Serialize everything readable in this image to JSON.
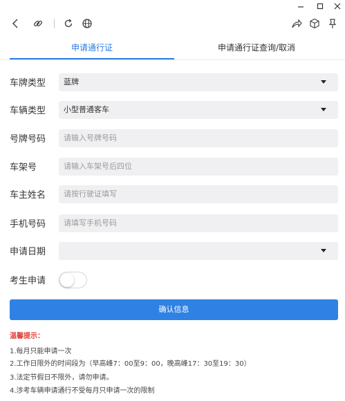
{
  "tabs": {
    "apply": "申请通行证",
    "query": "申请通行证查询/取消"
  },
  "form": {
    "plate_type": {
      "label": "车牌类型",
      "value": "蓝牌"
    },
    "vehicle_type": {
      "label": "车辆类型",
      "value": "小型普通客车"
    },
    "plate_number": {
      "label": "号牌号码",
      "placeholder": "请输入号牌号码"
    },
    "vin": {
      "label": "车架号",
      "placeholder": "请输入车架号后四位"
    },
    "owner_name": {
      "label": "车主姓名",
      "placeholder": "请按行驶证填写"
    },
    "phone": {
      "label": "手机号码",
      "placeholder": "请填写手机号码"
    },
    "apply_date": {
      "label": "申请日期",
      "value": ""
    },
    "examinee": {
      "label": "考生申请",
      "enabled": false
    }
  },
  "confirm_button": "确认信息",
  "tips": {
    "title": "温馨提示：",
    "items": [
      "1.每月只能申请一次",
      "2.工作日限外的时间段为（早高峰7：00至9：00，晚高峰17：30至19：30）",
      "3.法定节假日不限外，请勿申请。",
      "4.涉考车辆申请通行不受每月只申请一次的限制"
    ]
  },
  "colors": {
    "accent": "#2b7de0",
    "button": "#2f82e4",
    "tips_title": "#e0413b",
    "field_bg": "#f0f0f3"
  },
  "icons": {
    "toolbar": [
      "back-icon",
      "link-icon",
      "refresh-icon",
      "globe-icon",
      "share-icon",
      "cube-icon",
      "pin-icon"
    ],
    "window": [
      "minimize-icon",
      "maximize-icon",
      "close-icon"
    ]
  }
}
